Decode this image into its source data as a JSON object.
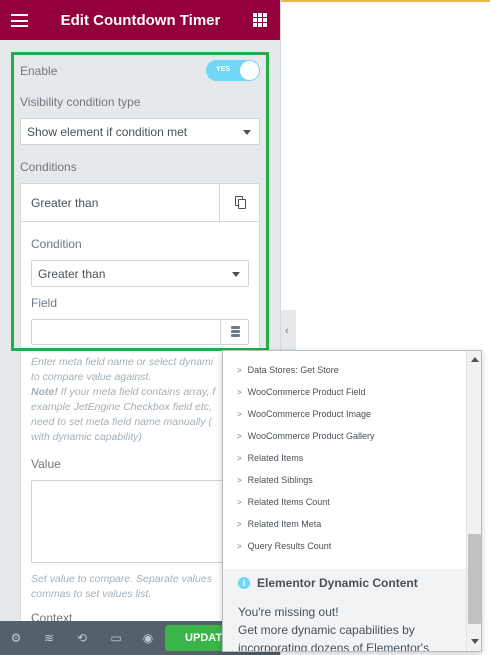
{
  "header": {
    "title": "Edit Countdown Timer",
    "menu_icon": "hamburger-icon",
    "widgets_icon": "grid-icon"
  },
  "enable": {
    "label": "Enable",
    "toggle_text": "YES",
    "on": true
  },
  "visibility": {
    "label": "Visibility condition type",
    "value": "Show element if condition met"
  },
  "conditions": {
    "label": "Conditions",
    "item_title": "Greater than",
    "condition_label": "Condition",
    "condition_value": "Greater than",
    "field_label": "Field",
    "field_value": "",
    "field_help_1": "Enter meta field name or select dynami",
    "field_help_2": "to compare value against.",
    "field_help_note": "Note!",
    "field_help_3": " If your meta field contains array, f",
    "field_help_4": "example JetEngine Checkbox field etc,",
    "field_help_5": "need to set meta field name manually (",
    "field_help_6": "with dynamic capability)",
    "value_label": "Value",
    "value_value": "",
    "value_help_1": "Set value to compare. Separate values",
    "value_help_2": "commas to set values list.",
    "context_label": "Context"
  },
  "footer": {
    "update_label": "UPDATE"
  },
  "dropdown": {
    "items": [
      "Data Stores: Get Store",
      "WooCommerce Product Field",
      "WooCommerce Product Image",
      "WooCommerce Product Gallery",
      "Related Items",
      "Related Siblings",
      "Related Items Count",
      "Related Item Meta",
      "Query Results Count"
    ],
    "promo_title": "Elementor Dynamic Content",
    "promo_line1": "You're missing out!",
    "promo_line2": "Get more dynamic capabilities by",
    "promo_line3": "incorporating dozens of Elementor's"
  },
  "colors": {
    "header": "#93003c",
    "highlight": "#23ae4a",
    "toggle": "#71d7f7",
    "update": "#39b54a",
    "footer": "#556068"
  }
}
